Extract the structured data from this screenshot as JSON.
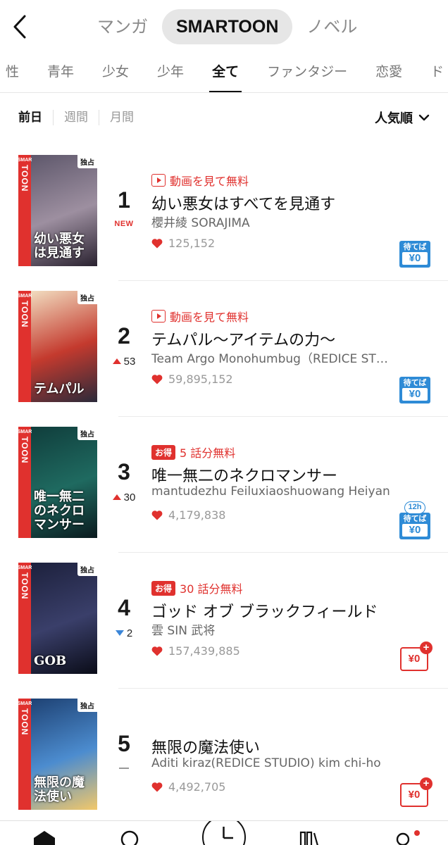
{
  "header": {
    "tabs": [
      {
        "label": "マンガ",
        "active": false
      },
      {
        "label": "SMARTOON",
        "active": true
      },
      {
        "label": "ノベル",
        "active": false
      }
    ]
  },
  "genres": [
    "性",
    "青年",
    "少女",
    "少年",
    "全て",
    "ファンタジー",
    "恋愛",
    "ド"
  ],
  "active_genre": "全て",
  "period": {
    "tabs": [
      "前日",
      "週間",
      "月間"
    ],
    "active": "前日",
    "sort_label": "人気順"
  },
  "items": [
    {
      "rank": "1",
      "change": "NEW",
      "change_dir": "new",
      "promo_type": "video",
      "promo_text": "動画を見て無料",
      "title": "幼い悪女はすべてを見通す",
      "author": "櫻井綾 SORAJIMA",
      "likes": "125,152",
      "cover_title": "幼い悪女は見通す",
      "cover_colors": [
        "#5a5468",
        "#9d8fa0",
        "#2a2230"
      ],
      "access": "wait",
      "wait_label": "待てば",
      "wait_price": "¥0"
    },
    {
      "rank": "2",
      "change": "53",
      "change_dir": "up",
      "promo_type": "video",
      "promo_text": "動画を見て無料",
      "title": "テムパル〜アイテムの力〜",
      "author": "Team Argo Monohumbug（REDICE STUDIO）",
      "likes": "59,895,152",
      "cover_title": "テムパル",
      "cover_colors": [
        "#f4e6c8",
        "#c43a2e",
        "#2b2a3a"
      ],
      "access": "wait",
      "wait_label": "待てば",
      "wait_price": "¥0"
    },
    {
      "rank": "3",
      "change": "30",
      "change_dir": "up",
      "promo_type": "deal",
      "deal_label": "お得",
      "promo_text": "5 話分無料",
      "title": "唯一無二のネクロマンサー",
      "author": "mantudezhu Feiluxiaoshuowang Heiyan",
      "likes": "4,179,838",
      "cover_title": "唯一無二のネクロマンサー",
      "cover_colors": [
        "#0f3b3a",
        "#1f6a60",
        "#0a1a1e"
      ],
      "access": "wait",
      "timer": "12h",
      "wait_label": "待てば",
      "wait_price": "¥0"
    },
    {
      "rank": "4",
      "change": "2",
      "change_dir": "down",
      "promo_type": "deal",
      "deal_label": "お得",
      "promo_text": "30 話分無料",
      "title": "ゴッド オブ ブラックフィールド",
      "author": "雲 SIN 武将",
      "likes": "157,439,885",
      "cover_title": "GOB",
      "cover_colors": [
        "#1b1f3a",
        "#3a3f6a",
        "#0a0c18"
      ],
      "access": "coin",
      "coin_price": "¥0"
    },
    {
      "rank": "5",
      "change": "",
      "change_dir": "same",
      "promo_type": "none",
      "promo_text": "",
      "title": "無限の魔法使い",
      "author": "Aditi kiraz(REDICE STUDIO) kim chi-ho",
      "likes": "4,492,705",
      "cover_title": "無限の魔法使い",
      "cover_colors": [
        "#1b3d6e",
        "#4c8ccf",
        "#f2c86a"
      ],
      "access": "coin",
      "coin_price": "¥0"
    }
  ],
  "cover_labels": {
    "badge_top": "SMAR",
    "badge_main": "TOON",
    "exclusive": "独占"
  },
  "colors": {
    "accent_red": "#e0312e",
    "wait_blue": "#2e8bd6",
    "heart": "#e0312e"
  },
  "bottom_nav": [
    "home-icon",
    "search-icon",
    "clock-icon",
    "bookshelf-icon",
    "mypage-icon"
  ]
}
